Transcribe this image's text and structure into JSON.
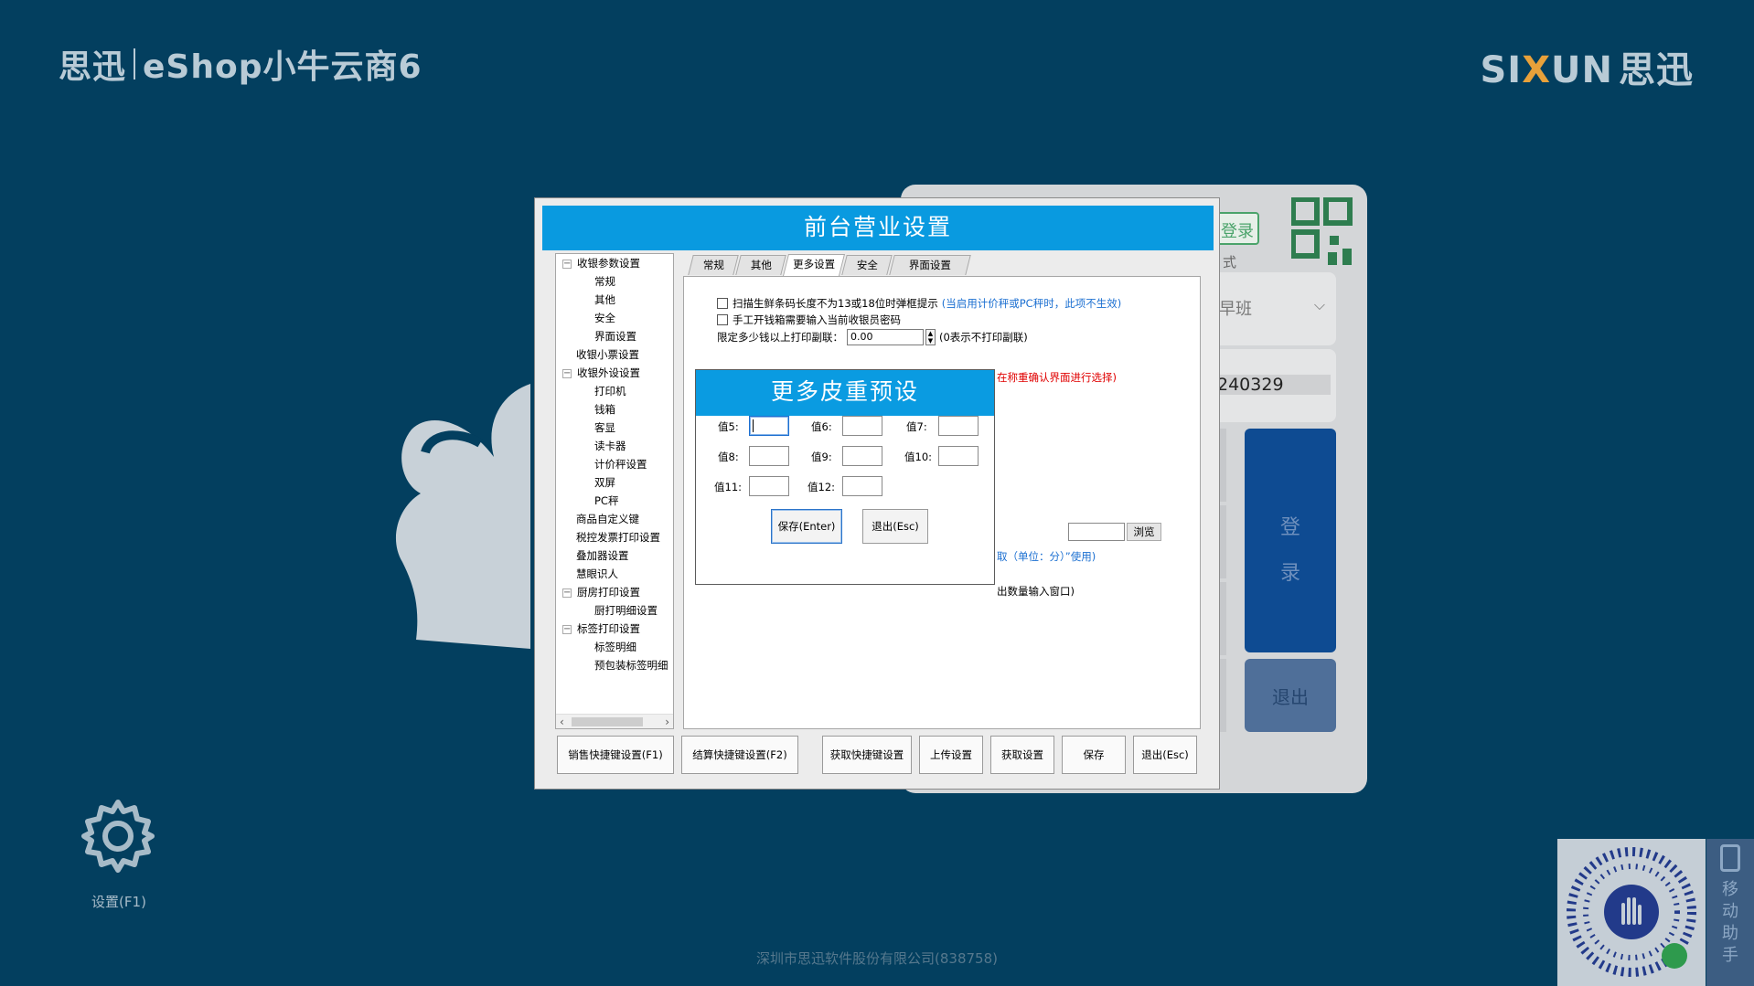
{
  "brand": {
    "left_logo": "思迅",
    "left_product": "eShop小牛云商6",
    "right_logo_a": "SI",
    "right_logo_x": "X",
    "right_logo_b": "UN",
    "right_logo_cn": "思迅"
  },
  "login": {
    "login_tab": "登录",
    "mode_text": "式",
    "shift_text": "早班",
    "account_text": "240329",
    "login_button_1": "登",
    "login_button_2": "录",
    "exit_button": "退出"
  },
  "settings_shortcut": {
    "label": "设置(F1)"
  },
  "footer": {
    "company": "深圳市思迅软件股份有限公司(838758)"
  },
  "mobile_helper": {
    "label": "移动助手"
  },
  "modal": {
    "title": "前台营业设置",
    "tree": [
      {
        "label": "收银参数设置",
        "level": 0,
        "expanded": true
      },
      {
        "label": "常规",
        "level": 1
      },
      {
        "label": "其他",
        "level": 1
      },
      {
        "label": "安全",
        "level": 1
      },
      {
        "label": "界面设置",
        "level": 1
      },
      {
        "label": "收银小票设置",
        "level": 0
      },
      {
        "label": "收银外设设置",
        "level": 0,
        "expanded": true
      },
      {
        "label": "打印机",
        "level": 1
      },
      {
        "label": "钱箱",
        "level": 1
      },
      {
        "label": "客显",
        "level": 1
      },
      {
        "label": "读卡器",
        "level": 1
      },
      {
        "label": "计价秤设置",
        "level": 1
      },
      {
        "label": "双屏",
        "level": 1
      },
      {
        "label": "PC秤",
        "level": 1
      },
      {
        "label": "商品自定义键",
        "level": 0
      },
      {
        "label": "税控发票打印设置",
        "level": 0
      },
      {
        "label": "叠加器设置",
        "level": 0
      },
      {
        "label": "慧眼识人",
        "level": 0
      },
      {
        "label": "厨房打印设置",
        "level": 0,
        "expanded": true
      },
      {
        "label": "厨打明细设置",
        "level": 1
      },
      {
        "label": "标签打印设置",
        "level": 0,
        "expanded": true
      },
      {
        "label": "标签明细",
        "level": 1
      },
      {
        "label": "预包装标签明细",
        "level": 1
      }
    ],
    "tabs": [
      "常规",
      "其他",
      "更多设置",
      "安全",
      "界面设置"
    ],
    "active_tab": "更多设置",
    "options": {
      "scan_fresh_label": "扫描生鲜条码长度不为13或18位时弹框提示",
      "scan_fresh_note": "(当启用计价秤或PC秤时，此项不生效)",
      "cashbox_pwd_label": "手工开钱箱需要输入当前收银员密码",
      "print_threshold_label": "限定多少钱以上打印副联：",
      "print_threshold_value": "0.00",
      "print_threshold_note": "(0表示不打印副联)"
    },
    "background_fragments": {
      "scale_hint": "在称重确认界面进行选择)",
      "browse": "浏览",
      "unit_hint": "取（单位：分）”使用)",
      "qty_hint": "出数量输入窗口)"
    },
    "tare_dialog": {
      "title": "更多皮重预设",
      "fields": [
        {
          "label": "值5:",
          "value": ""
        },
        {
          "label": "值6:",
          "value": ""
        },
        {
          "label": "值7:",
          "value": ""
        },
        {
          "label": "值8:",
          "value": ""
        },
        {
          "label": "值9:",
          "value": ""
        },
        {
          "label": "值10:",
          "value": ""
        },
        {
          "label": "值11:",
          "value": ""
        },
        {
          "label": "值12:",
          "value": ""
        }
      ],
      "save_button": "保存(Enter)",
      "exit_button": "退出(Esc)"
    },
    "bottom_buttons": {
      "sale_hotkey": "销售快捷键设置(F1)",
      "settle_hotkey": "结算快捷键设置(F2)",
      "fetch_hotkey": "获取快捷键设置",
      "upload": "上传设置",
      "fetch": "获取设置",
      "save": "保存",
      "exit": "退出(Esc)"
    }
  },
  "colors": {
    "background": "#033f5f",
    "title_bar": "#099ae0",
    "login_button": "#0e4b92",
    "warning_text": "#e00000",
    "note_text": "#1b6fd1"
  }
}
